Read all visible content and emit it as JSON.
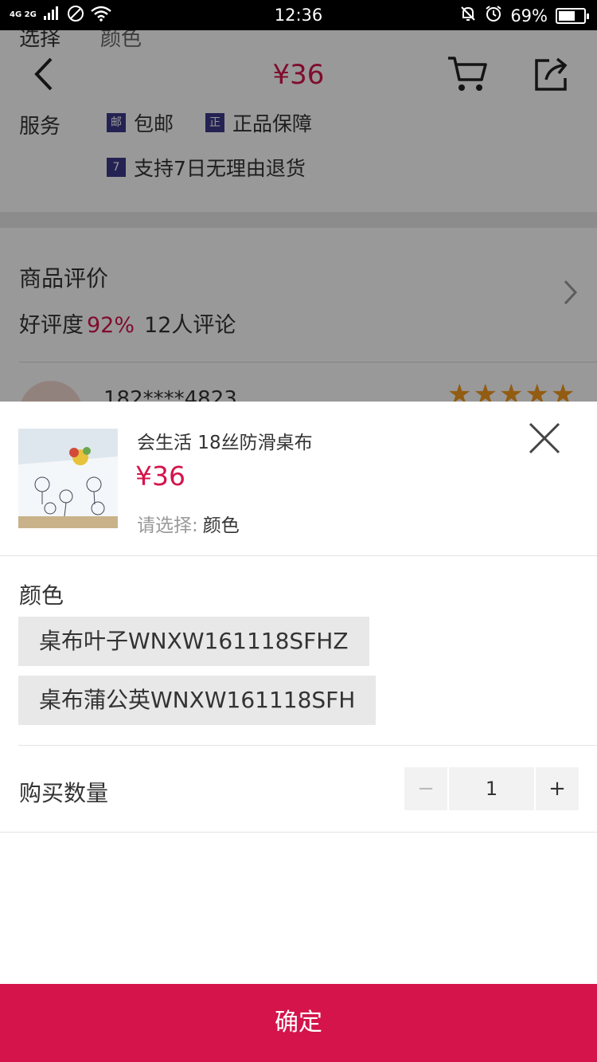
{
  "status_bar": {
    "network": "4G 2G",
    "time": "12:36",
    "battery": "69%"
  },
  "background": {
    "select_label": "选择",
    "select_value": "颜色",
    "nav_price": "¥36",
    "services_label": "服务",
    "services": [
      {
        "badge": "邮",
        "label": "包邮"
      },
      {
        "badge": "正",
        "label": "正品保障"
      },
      {
        "badge": "7",
        "label": "支持7日无理由退货"
      }
    ],
    "review_title": "商品评价",
    "review_rate_label": "好评度",
    "review_rate": "92%",
    "review_count": "12人评论",
    "review_user": "182****4823",
    "review_stars": 5
  },
  "sheet": {
    "product_title": "会生活 18丝防滑桌布",
    "price": "¥36",
    "choose_label": "请选择:",
    "choose_value": "颜色",
    "color_label": "颜色",
    "options": [
      "桌布叶子WNXW161118SFHZ",
      "桌布蒲公英WNXW161118SFH"
    ],
    "quantity_label": "购买数量",
    "quantity": "1",
    "minus": "−",
    "plus": "+",
    "confirm": "确定"
  },
  "colors": {
    "accent": "#d4144b",
    "option_bg": "#e8e8e8",
    "badge": "#3d3a8a"
  }
}
